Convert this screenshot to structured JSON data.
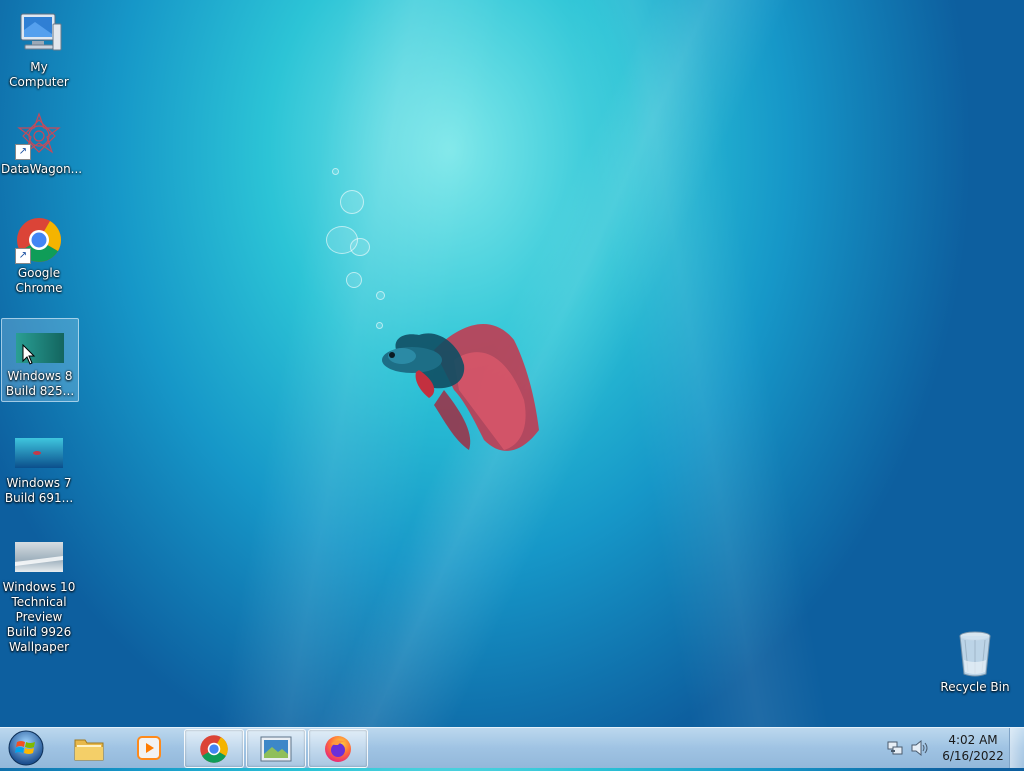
{
  "desktop": {
    "icons": [
      {
        "label": "My Computer",
        "icon": "computer-icon"
      },
      {
        "label": "DataWagon...",
        "icon": "datawagon-icon",
        "shortcut": true
      },
      {
        "label": "Google Chrome",
        "icon": "chrome-icon",
        "shortcut": true
      },
      {
        "label": "Windows 8 Build 825...",
        "icon": "image-file-icon",
        "selected": true
      },
      {
        "label": "Windows 7 Build 691...",
        "icon": "image-file-icon"
      },
      {
        "label": "Windows 10 Technical Preview Build 9926 Wallpaper",
        "icon": "image-file-icon"
      },
      {
        "label": "Recycle Bin",
        "icon": "recycle-bin-icon"
      }
    ]
  },
  "taskbar": {
    "start_icon": "windows-orb-icon",
    "pinned": [
      {
        "name": "explorer",
        "icon": "folder-icon",
        "active": false
      },
      {
        "name": "media-player",
        "icon": "media-player-icon",
        "active": false
      },
      {
        "name": "chrome",
        "icon": "chrome-icon",
        "active": true
      },
      {
        "name": "photo-viewer",
        "icon": "photo-viewer-icon",
        "active": true
      },
      {
        "name": "firefox",
        "icon": "firefox-icon",
        "active": true
      }
    ],
    "tray_icons": [
      "network-icon",
      "volume-icon"
    ],
    "clock": {
      "time": "4:02 AM",
      "date": "6/16/2022"
    }
  }
}
